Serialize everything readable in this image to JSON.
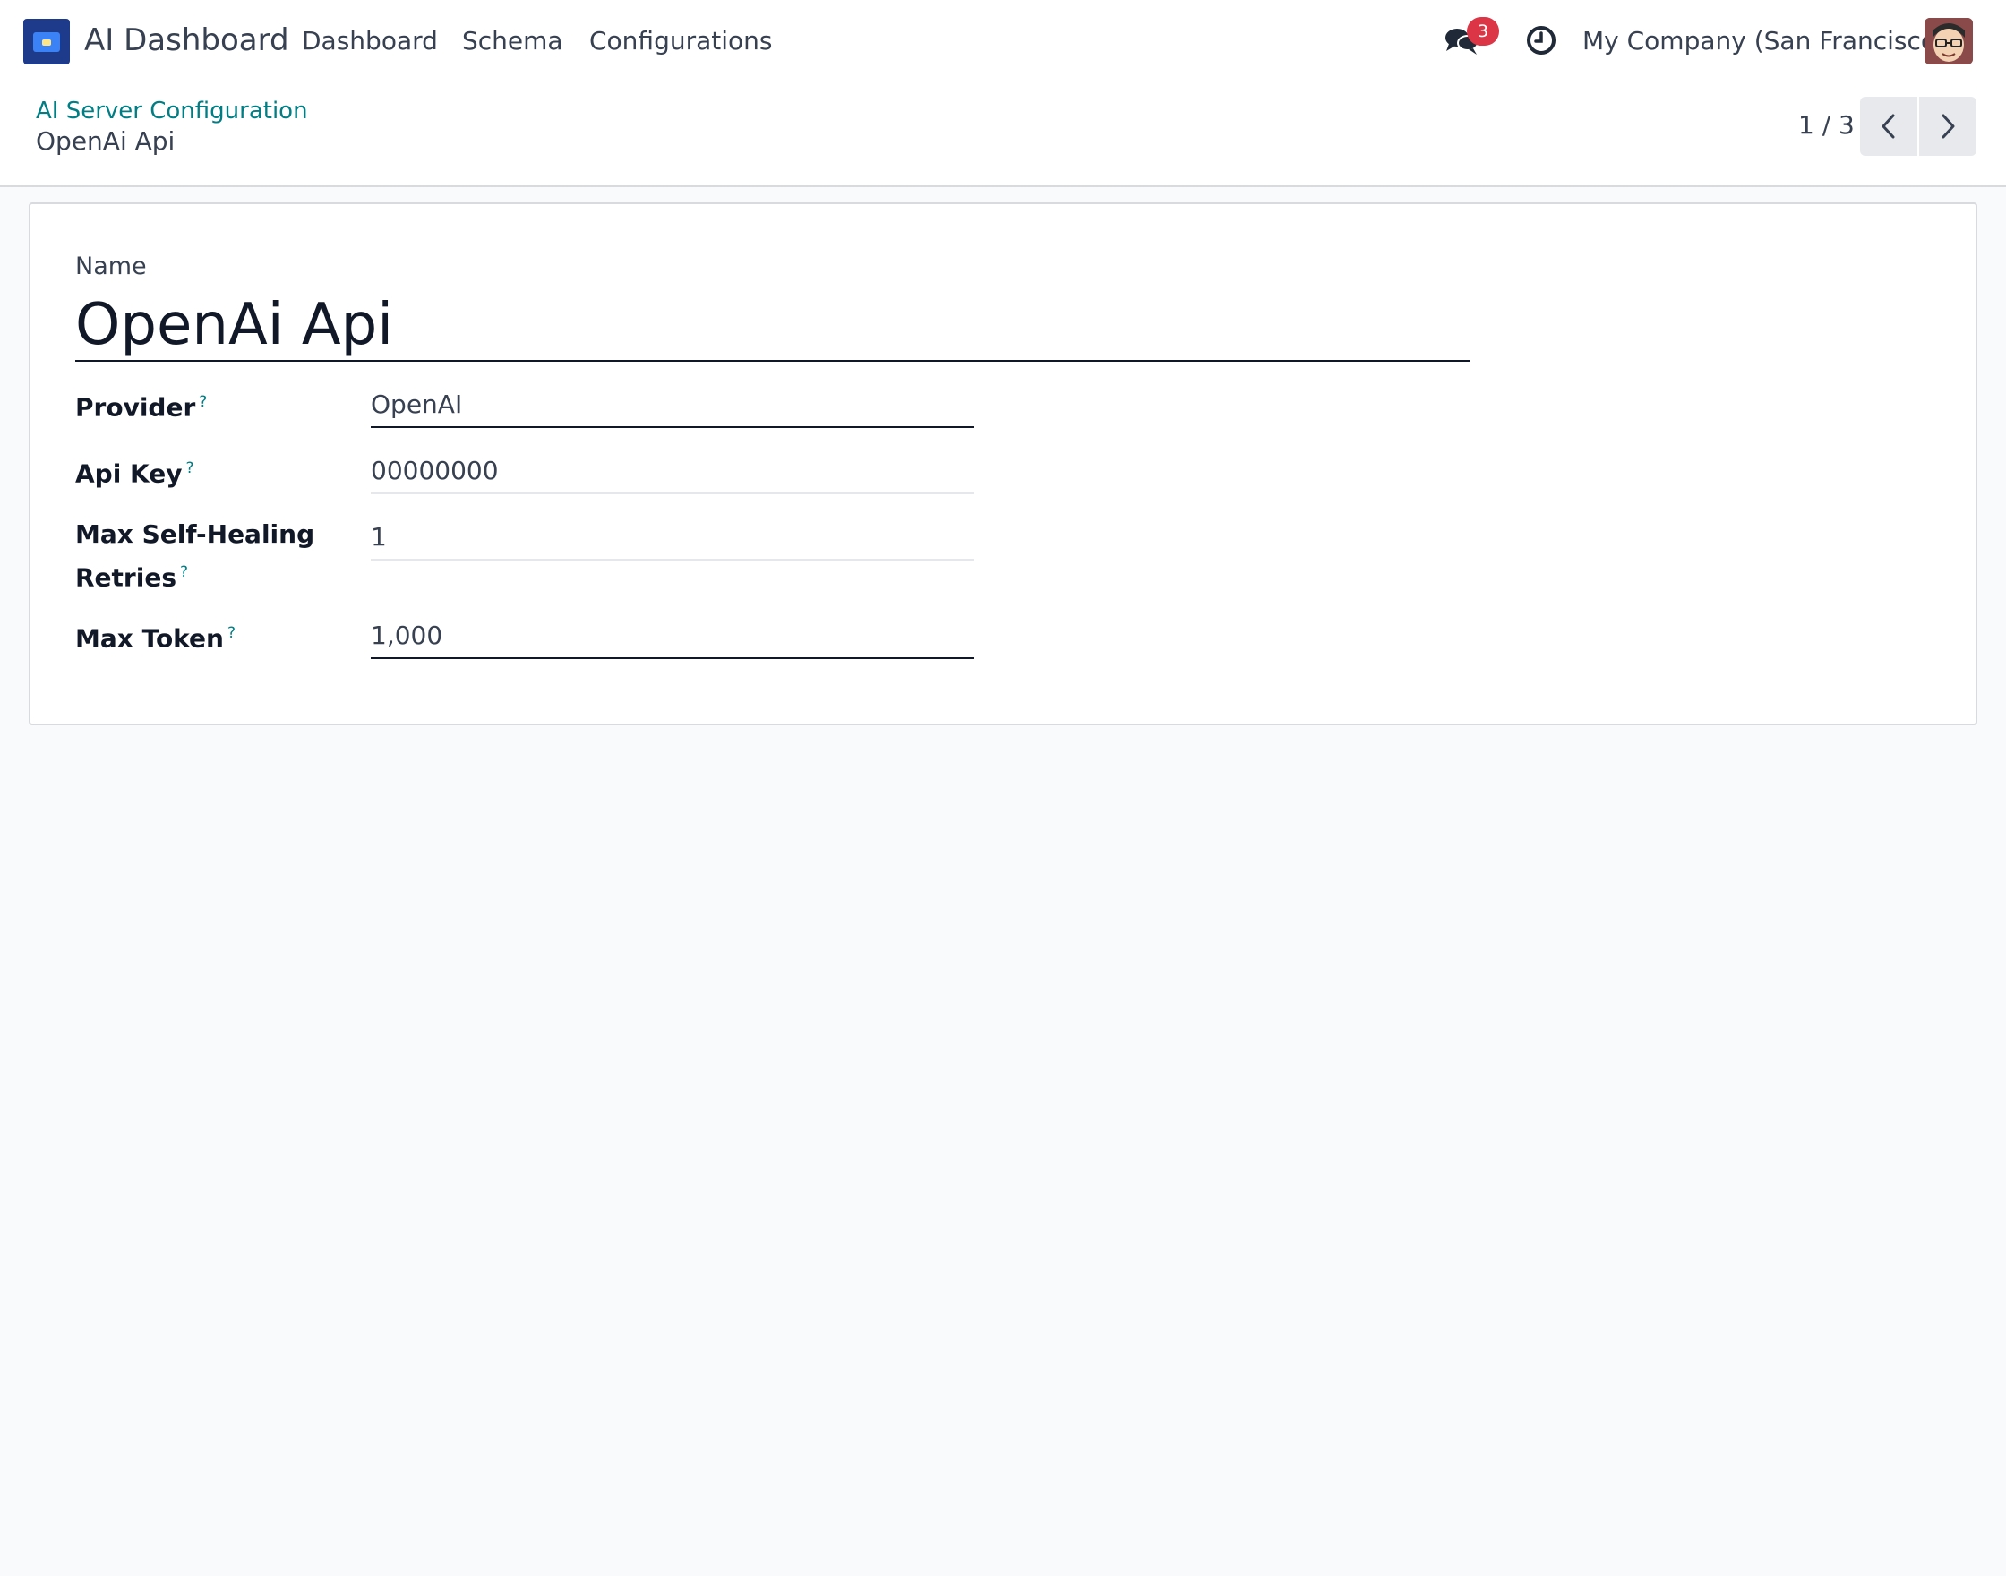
{
  "navbar": {
    "app_title": "AI Dashboard",
    "menu": [
      "Dashboard",
      "Schema",
      "Configurations"
    ],
    "messages_badge": "3",
    "company": "My Company (San Francisco)"
  },
  "breadcrumb": {
    "parent": "AI Server Configuration",
    "current": "OpenAi Api"
  },
  "pager": {
    "value": "1 / 3"
  },
  "form": {
    "name_label": "Name",
    "name_value": "OpenAi Api",
    "help_marker": "?",
    "fields": [
      {
        "label": "Provider",
        "value": "OpenAI"
      },
      {
        "label": "Api Key",
        "value": "00000000"
      },
      {
        "label": "Max Self-Healing Retries",
        "value": "1"
      },
      {
        "label": "Max Token",
        "value": "1,000"
      }
    ]
  },
  "colors": {
    "accent": "#017e84",
    "badge": "#dc3545",
    "app_icon": "#1e3a8a"
  }
}
